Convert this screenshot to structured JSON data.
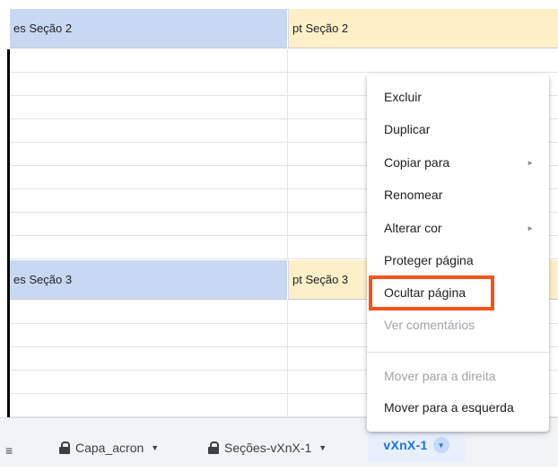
{
  "sheet": {
    "sections": [
      {
        "es": "es Seção 2",
        "pt": "pt Seção 2"
      },
      {
        "es": "es Seção 3",
        "pt": "pt Seção 3"
      }
    ]
  },
  "context_menu": {
    "items": [
      {
        "label": "Excluir",
        "enabled": true,
        "submenu": false
      },
      {
        "label": "Duplicar",
        "enabled": true,
        "submenu": false
      },
      {
        "label": "Copiar para",
        "enabled": true,
        "submenu": true
      },
      {
        "label": "Renomear",
        "enabled": true,
        "submenu": false
      },
      {
        "label": "Alterar cor",
        "enabled": true,
        "submenu": true
      },
      {
        "label": "Proteger página",
        "enabled": true,
        "submenu": false
      },
      {
        "label": "Ocultar página",
        "enabled": true,
        "submenu": false,
        "highlighted": true
      },
      {
        "label": "Ver comentários",
        "enabled": false,
        "submenu": false
      },
      {
        "label": "Mover para a direita",
        "enabled": false,
        "submenu": false
      },
      {
        "label": "Mover para a esquerda",
        "enabled": true,
        "submenu": false
      }
    ],
    "submenu_arrow": "►",
    "highlight_color": "#f2541b"
  },
  "tabs": {
    "menu_icon": "≡",
    "caret": "▼",
    "items": [
      {
        "label": "Capa_acron",
        "locked": true
      },
      {
        "label": "Seções-vXnX-1",
        "locked": true
      },
      {
        "label": "vXnX-1",
        "locked": false,
        "active": true
      }
    ],
    "active_color": "#1a73e8"
  }
}
